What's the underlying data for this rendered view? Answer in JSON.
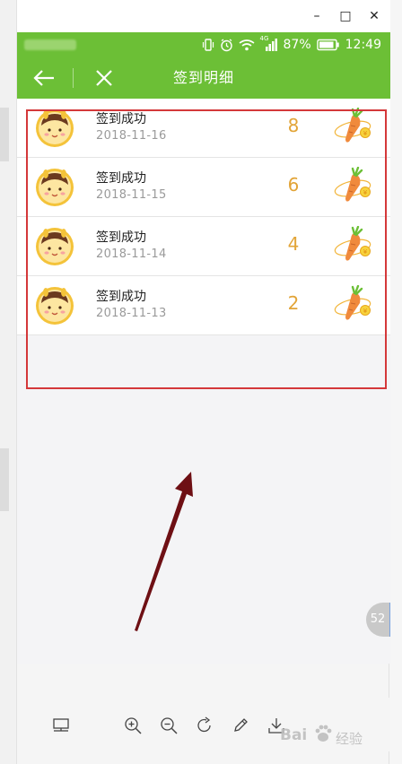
{
  "window": {
    "controls": {
      "minimize": "–",
      "maximize": "□",
      "close": "✕"
    }
  },
  "statusbar": {
    "battery_percent": "87%",
    "time": "12:49",
    "signal_label": "4G"
  },
  "navbar": {
    "title": "签到明细"
  },
  "records": [
    {
      "title": "签到成功",
      "date": "2018-11-16",
      "points": "8"
    },
    {
      "title": "签到成功",
      "date": "2018-11-15",
      "points": "6"
    },
    {
      "title": "签到成功",
      "date": "2018-11-14",
      "points": "4"
    },
    {
      "title": "签到成功",
      "date": "2018-11-13",
      "points": "2"
    }
  ],
  "bubble": {
    "count": "52"
  },
  "watermark": {
    "brand": "Bai",
    "brand_tail": "经验"
  },
  "colors": {
    "brand_green": "#6cbf36",
    "points_gold": "#e2a437",
    "highlight_red": "#d4383a",
    "arrow_dark_red": "#6e0f14"
  }
}
